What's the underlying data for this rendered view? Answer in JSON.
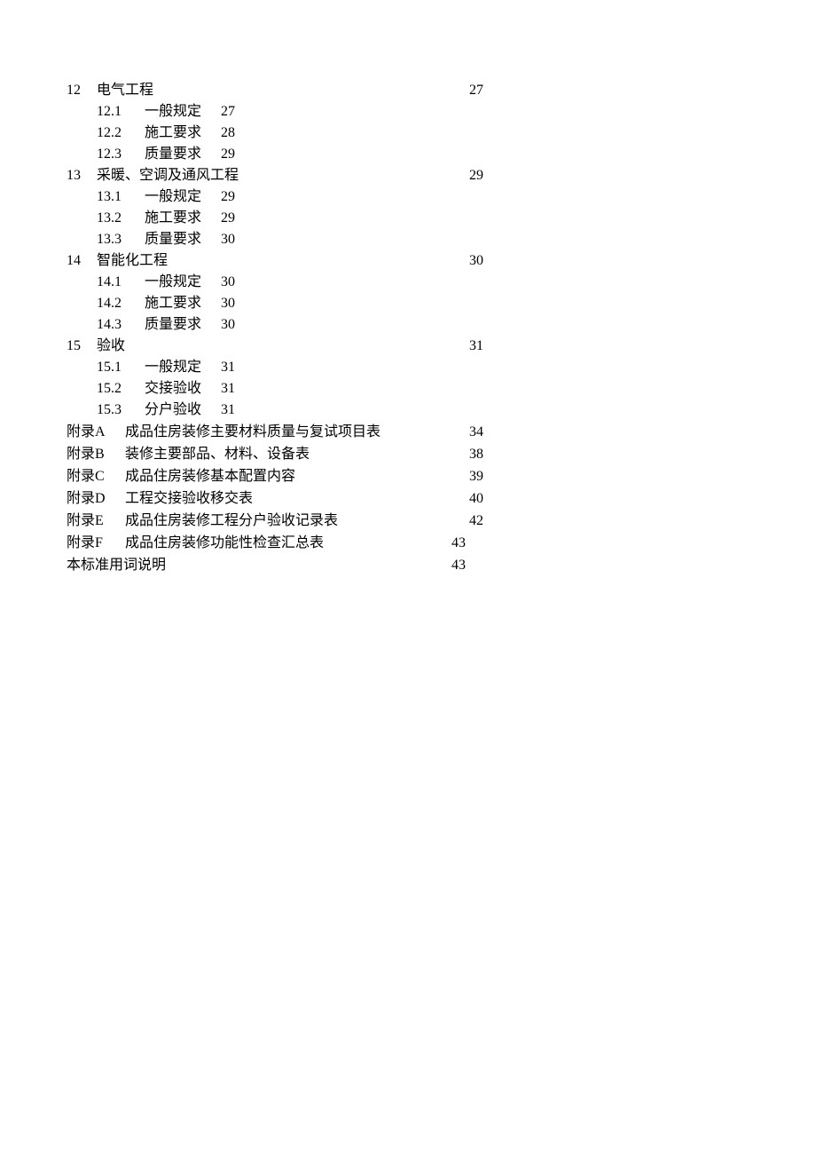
{
  "chapters": [
    {
      "num": "12",
      "title": "电气工程",
      "page": "27",
      "subs": [
        {
          "num": "12.1",
          "title": "一般规定",
          "page": "27"
        },
        {
          "num": "12.2",
          "title": "施工要求",
          "page": "28"
        },
        {
          "num": "12.3",
          "title": "质量要求",
          "page": "29"
        }
      ]
    },
    {
      "num": "13",
      "title": "采暖、空调及通风工程",
      "page": "29",
      "subs": [
        {
          "num": "13.1",
          "title": "一般规定",
          "page": "29"
        },
        {
          "num": "13.2",
          "title": "施工要求",
          "page": "29"
        },
        {
          "num": "13.3",
          "title": "质量要求",
          "page": "30"
        }
      ]
    },
    {
      "num": "14",
      "title": "智能化工程",
      "page": "30",
      "subs": [
        {
          "num": "14.1",
          "title": "一般规定",
          "page": "30"
        },
        {
          "num": "14.2",
          "title": " 施工要求",
          "page": "30"
        },
        {
          "num": "14.3",
          "title": "质量要求",
          "page": "30"
        }
      ]
    },
    {
      "num": "15",
      "title": "验收",
      "page": "31",
      "subs": [
        {
          "num": "15.1",
          "title": "一般规定",
          "page": "31"
        },
        {
          "num": "15.2",
          "title": "交接验收",
          "page": "31"
        },
        {
          "num": "15.3",
          "title": "分户验收",
          "page": "31"
        }
      ]
    }
  ],
  "appendices": [
    {
      "label": "附录A",
      "title": "成品住房装修主要材料质量与复试项目表",
      "page": "34"
    },
    {
      "label": "附录B",
      "title": "装修主要部品、材料、设备表",
      "page": "38"
    },
    {
      "label": "附录C",
      "title": "成品住房装修基本配置内容",
      "page": "39"
    },
    {
      "label": "附录D",
      "title": "工程交接验收移交表",
      "page": "40"
    },
    {
      "label": "附录E",
      "title": "成品住房装修工程分户验收记录表",
      "page": "42"
    },
    {
      "label": "附录F",
      "title": "成品住房装修功能性检查汇总表",
      "page": "43"
    }
  ],
  "footer": {
    "title": "本标准用词说明",
    "page": "43"
  }
}
